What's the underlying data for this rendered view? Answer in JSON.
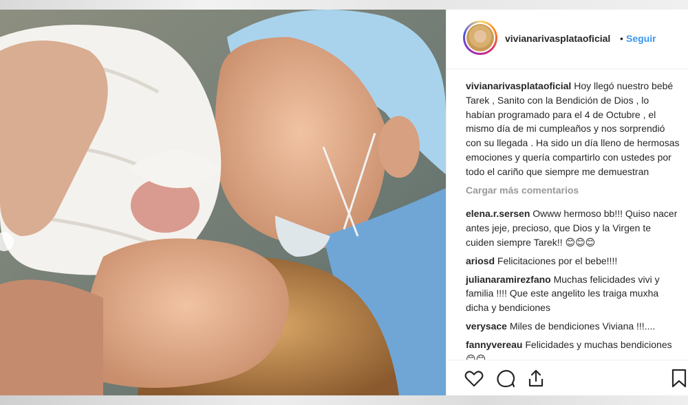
{
  "post": {
    "username": "vivianarivasplataoficial",
    "separator": "•",
    "follow_label": "Seguir",
    "caption": "Hoy llegó nuestro bebé Tarek , Sanito con la Bendición de Dios , lo habían programado para el 4 de Octubre , el mismo día de mi cumpleaños y nos sorprendió con su llegada . Ha sido un día lleno de hermosas emociones y quería compartirlo con ustedes por todo el cariño que siempre me demuestran",
    "load_more_label": "Cargar más comentarios"
  },
  "comments": [
    {
      "user": "elena.r.sersen",
      "text": "Owww hermoso bb!!! Quiso nacer antes jeje, precioso, que Dios y la Virgen te cuiden siempre Tarek!! 😊😊😊"
    },
    {
      "user": "ariosd",
      "text": "Felicitaciones por el bebe!!!!"
    },
    {
      "user": "julianaramirezfano",
      "text": "Muchas felicidades vivi y familia !!!! Que este angelito les traiga muxha dicha y bendiciones"
    },
    {
      "user": "verysace",
      "text": "Miles de bendiciones Viviana !!!...."
    },
    {
      "user": "fannyvereau",
      "text": "Felicidades y muchas bendiciones 😊😊"
    }
  ],
  "icons": {
    "like": "heart-icon",
    "comment": "comment-icon",
    "share": "share-icon",
    "save": "bookmark-icon"
  },
  "colors": {
    "accent": "#3897f0",
    "muted": "#999999",
    "text": "#262626"
  }
}
